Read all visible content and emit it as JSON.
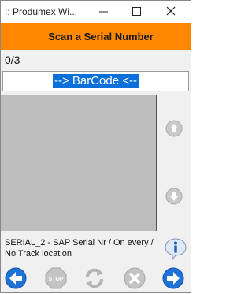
{
  "window": {
    "title": ":: Produmex Wi..."
  },
  "header": {
    "title": "Scan a Serial Number"
  },
  "counter": "0/3",
  "barcode": {
    "value": "--> BarCode <--"
  },
  "info": {
    "text": "SERIAL_2 - SAP Serial Nr / On every / No Track location"
  },
  "icons": {
    "minimize": "minimize-icon",
    "maximize": "maximize-icon",
    "close": "close-icon",
    "scroll_up": "arrow-up-icon",
    "scroll_down": "arrow-down-icon",
    "info": "info-icon",
    "back": "arrow-left-icon",
    "stop": "stop-icon",
    "refresh": "refresh-icon",
    "cancel": "cancel-icon",
    "next": "arrow-right-icon"
  },
  "colors": {
    "header": "#ff8800",
    "selection": "#0a6fd8",
    "nav_blue": "#1f73d6",
    "disabled_gray": "#b8b8b8"
  }
}
